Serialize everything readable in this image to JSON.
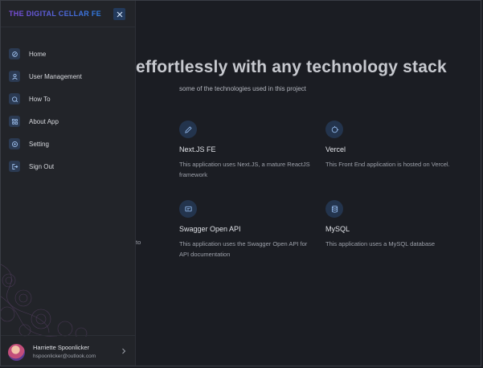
{
  "sidebar": {
    "brand": "THE DIGITAL CELLAR FE",
    "nav": [
      {
        "label": "Home",
        "icon": "home-icon"
      },
      {
        "label": "User Management",
        "icon": "user-icon"
      },
      {
        "label": "How To",
        "icon": "help-icon"
      },
      {
        "label": "About App",
        "icon": "apps-icon"
      },
      {
        "label": "Setting",
        "icon": "settings-icon"
      },
      {
        "label": "Sign Out",
        "icon": "sign-out-icon"
      }
    ],
    "user": {
      "name": "Harriette Spoonlicker",
      "email": "hspoonlicker@outlook.com"
    }
  },
  "main": {
    "title": "effortlessly with any technology stack",
    "subtitle": "some of the technologies used in this project",
    "cards": [
      {
        "title": "Next.JS FE",
        "desc": "This application uses Next.JS, a mature ReactJS framework",
        "icon": "pencil-icon"
      },
      {
        "title": "Vercel",
        "desc": "This Front End application is hosted on Vercel.",
        "icon": "hosting-icon"
      },
      {
        "title": "Swagger Open API",
        "desc": "This application uses the Swagger Open API for API documentation",
        "icon": "message-icon"
      },
      {
        "title": "MySQL",
        "desc": "This application uses a MySQL database",
        "icon": "database-icon"
      }
    ],
    "partial_text": "to"
  },
  "colors": {
    "accent": "#233a5c",
    "background": "#1b1d23",
    "sidebar": "#222429"
  }
}
